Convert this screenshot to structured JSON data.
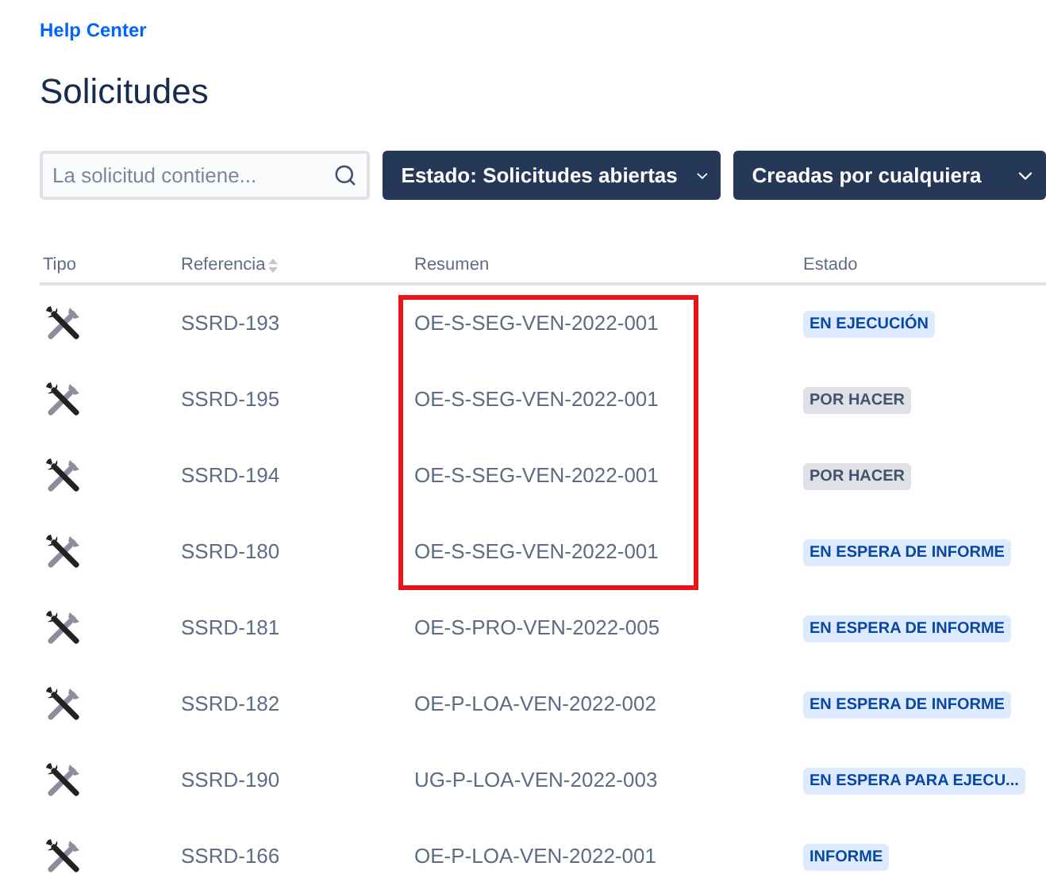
{
  "breadcrumb": "Help Center",
  "title": "Solicitudes",
  "search": {
    "placeholder": "La solicitud contiene..."
  },
  "filters": [
    {
      "label": "Estado: Solicitudes abiertas"
    },
    {
      "label": "Creadas por cualquiera"
    }
  ],
  "table": {
    "columns": [
      "Tipo",
      "Referencia",
      "Resumen",
      "Estado"
    ],
    "rows": [
      {
        "reference": "SSRD-193",
        "summary": "OE-S-SEG-VEN-2022-001",
        "status": "EN EJECUCIÓN",
        "color": "#deebff",
        "highlighted": true
      },
      {
        "reference": "SSRD-195",
        "summary": "OE-S-SEG-VEN-2022-001",
        "status": "POR HACER",
        "color": "#dfe1e6",
        "highlighted": true
      },
      {
        "reference": "SSRD-194",
        "summary": "OE-S-SEG-VEN-2022-001",
        "status": "POR HACER",
        "color": "#dfe1e6",
        "highlighted": true
      },
      {
        "reference": "SSRD-180",
        "summary": "OE-S-SEG-VEN-2022-001",
        "status": "EN ESPERA DE INFORME",
        "color": "#deebff",
        "highlighted": true
      },
      {
        "reference": "SSRD-181",
        "summary": "OE-S-PRO-VEN-2022-005",
        "status": "EN ESPERA DE INFORME",
        "color": "#deebff",
        "highlighted": false
      },
      {
        "reference": "SSRD-182",
        "summary": "OE-P-LOA-VEN-2022-002",
        "status": "EN ESPERA DE INFORME",
        "color": "#deebff",
        "highlighted": false
      },
      {
        "reference": "SSRD-190",
        "summary": "UG-P-LOA-VEN-2022-003",
        "status": "EN ESPERA PARA EJECU...",
        "color": "#deebff",
        "highlighted": false
      },
      {
        "reference": "SSRD-166",
        "summary": "OE-P-LOA-VEN-2022-001",
        "status": "INFORME",
        "color": "#deebff",
        "highlighted": false
      }
    ]
  }
}
